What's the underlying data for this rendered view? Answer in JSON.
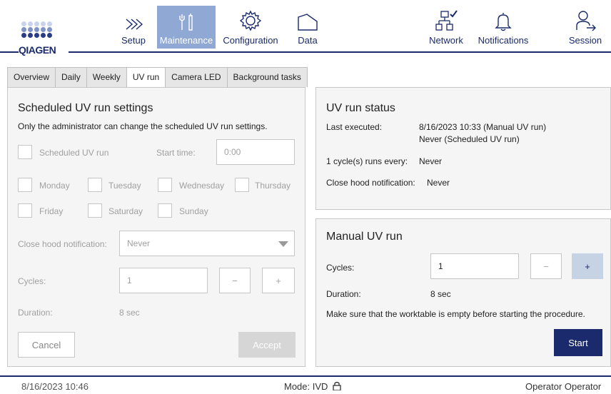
{
  "brand": {
    "name": "QIAGEN"
  },
  "nav": {
    "setup": "Setup",
    "maintenance": "Maintenance",
    "configuration": "Configuration",
    "data": "Data",
    "network": "Network",
    "notifications": "Notifications",
    "session": "Session"
  },
  "tabs": [
    "Overview",
    "Daily",
    "Weekly",
    "UV run",
    "Camera LED",
    "Background tasks"
  ],
  "scheduled": {
    "title": "Scheduled UV run settings",
    "note": "Only the administrator can change the scheduled UV run settings.",
    "scheduled_uv_run": "Scheduled UV run",
    "start_time_label": "Start time:",
    "start_time_value": "0:00",
    "days": [
      "Monday",
      "Tuesday",
      "Wednesday",
      "Thursday",
      "Friday",
      "Saturday",
      "Sunday"
    ],
    "close_hood_label": "Close hood notification:",
    "close_hood_value": "Never",
    "cycles_label": "Cycles:",
    "cycles_value": "1",
    "minus": "−",
    "plus": "+",
    "duration_label": "Duration:",
    "duration_value": "8 sec",
    "cancel": "Cancel",
    "accept": "Accept"
  },
  "status": {
    "title": "UV run status",
    "last_executed_label": "Last executed:",
    "last_executed_value1": "8/16/2023 10:33 (Manual UV run)",
    "last_executed_value2": "Never (Scheduled UV run)",
    "cycle_label": "1 cycle(s) runs every:",
    "cycle_value": "Never",
    "close_hood_label": "Close hood notification:",
    "close_hood_value": "Never"
  },
  "manual": {
    "title": "Manual UV run",
    "cycles_label": "Cycles:",
    "cycles_value": "1",
    "minus": "−",
    "plus": "+",
    "duration_label": "Duration:",
    "duration_value": "8 sec",
    "note": "Make sure that the worktable is empty before starting the procedure.",
    "start": "Start"
  },
  "footer": {
    "datetime": "8/16/2023 10:46",
    "mode": "Mode: IVD",
    "user": "Operator Operator"
  },
  "colors": {
    "brand": "#1a2a6c",
    "active_nav": "#8fa8d4",
    "start_button": "#1a2a6c",
    "plus_button": "#c5d3e4"
  }
}
